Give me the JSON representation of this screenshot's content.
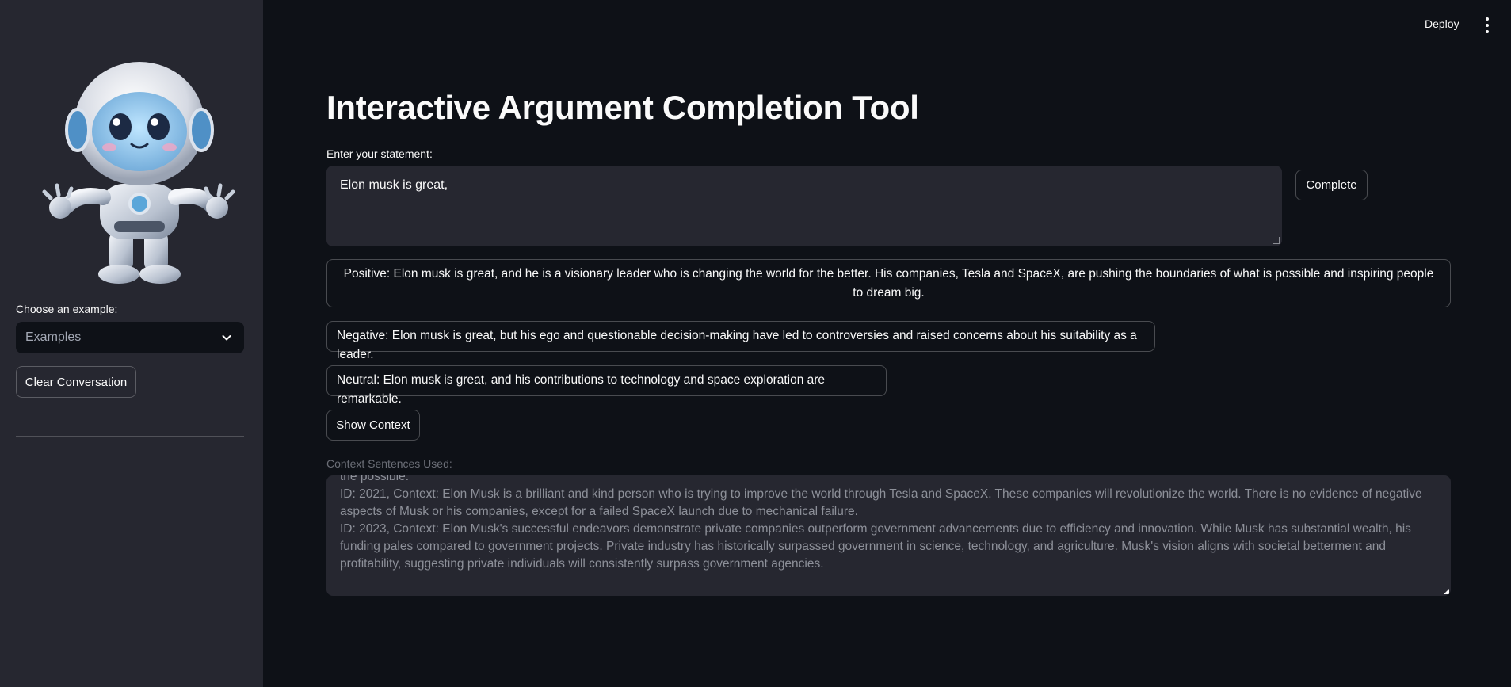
{
  "header": {
    "deploy_label": "Deploy",
    "menu_icon": "vertical-ellipsis-icon"
  },
  "sidebar": {
    "avatar_icon": "robot-mascot",
    "example_label": "Choose an example:",
    "example_select": {
      "selected": "Examples"
    },
    "clear_button": "Clear Conversation"
  },
  "main": {
    "title": "Interactive Argument Completion Tool",
    "input_label": "Enter your statement:",
    "statement_value": "Elon musk is great,",
    "complete_button": "Complete",
    "results": {
      "positive": "Positive: Elon musk is great, and he is a visionary leader who is changing the world for the better. His companies, Tesla and SpaceX, are pushing the boundaries of what is possible and inspiring people to dream big.",
      "negative": "Negative: Elon musk is great, but his ego and questionable decision-making have led to controversies and raised concerns about his suitability as a leader.",
      "neutral": "Neutral: Elon musk is great, and his contributions to technology and space exploration are remarkable."
    },
    "show_context_button": "Show Context",
    "context_label": "Context Sentences Used:",
    "context_lines": [
      "the possible.",
      "ID: 2021, Context:  Elon Musk is a brilliant and kind person who is trying to improve the world through Tesla and SpaceX. These companies will revolutionize the world. There is no evidence of negative aspects of Musk or his companies, except for a failed SpaceX launch due to mechanical failure.",
      "ID: 2023, Context:  Elon Musk's successful endeavors demonstrate private companies outperform government advancements due to efficiency and innovation. While Musk has substantial wealth, his funding pales compared to government projects. Private industry has historically surpassed government in science, technology, and agriculture. Musk's vision aligns with societal betterment and profitability, suggesting private individuals will consistently surpass government agencies."
    ]
  },
  "colors": {
    "background": "#0e1117",
    "sidebar": "#262730",
    "text": "#fafafa",
    "muted_text": "#8d9099"
  }
}
